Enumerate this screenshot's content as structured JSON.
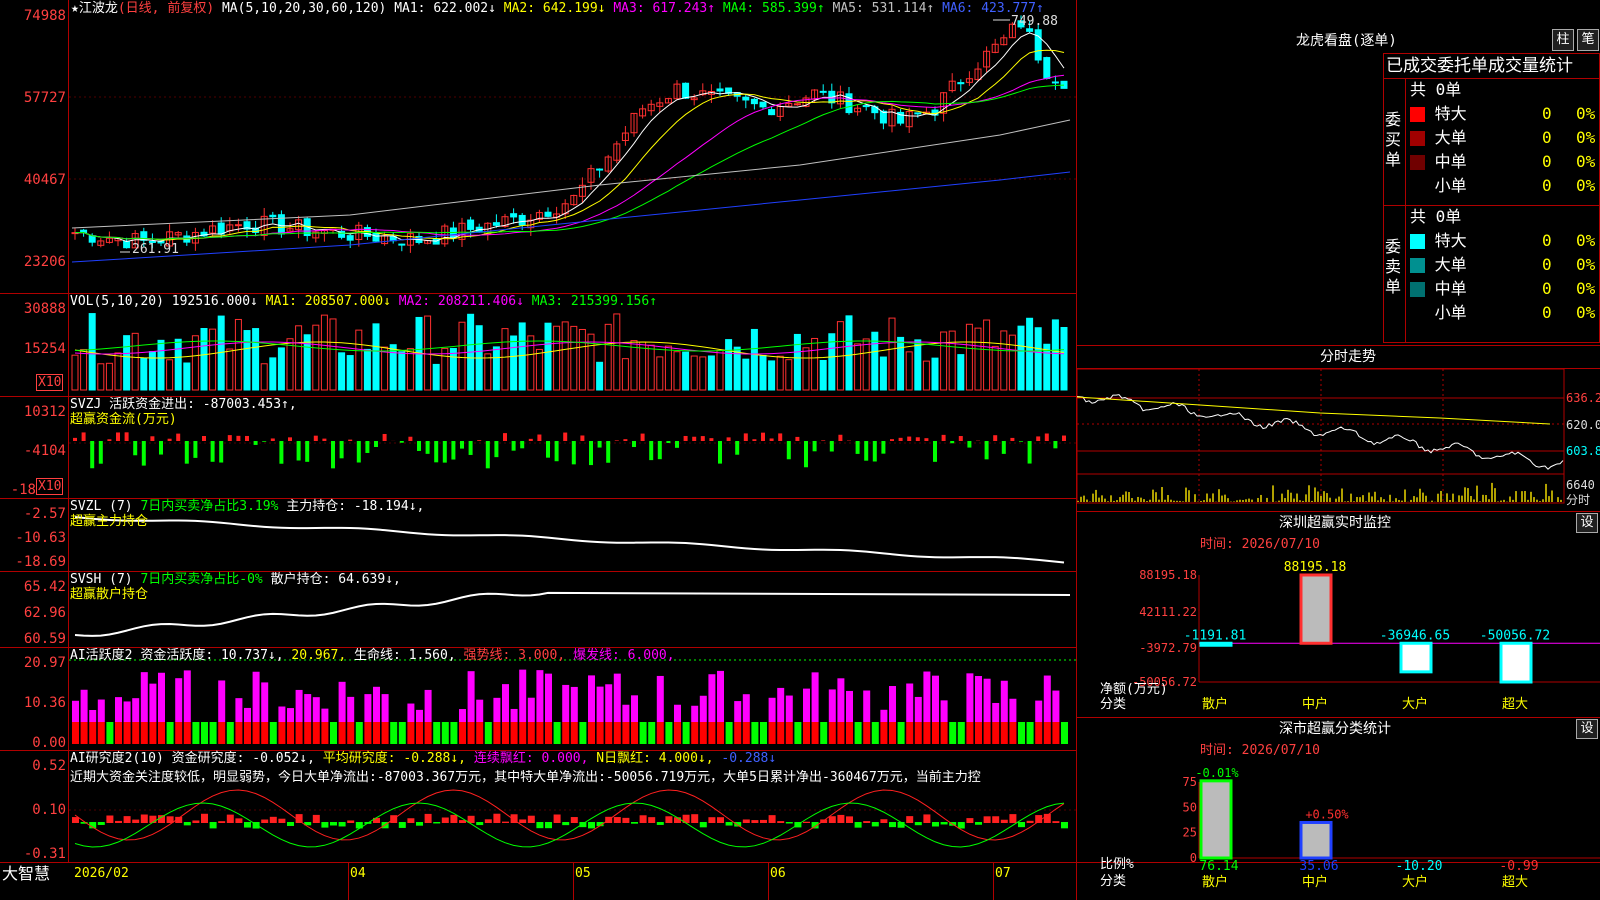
{
  "stock": {
    "title": "江波龙",
    "mode": "(日线, 前复权)",
    "ma_label": "MA(5,10,20,30,60,120)",
    "ma": [
      {
        "t": "MA1: 622.002↓",
        "c": "#ffffff"
      },
      {
        "t": "MA2: 642.199↓",
        "c": "#ffff00"
      },
      {
        "t": "MA3: 617.243↑",
        "c": "#ff00ff"
      },
      {
        "t": "MA4: 585.399↑",
        "c": "#00ff00"
      },
      {
        "t": "MA5: 531.114↑",
        "c": "#c0c0c0"
      },
      {
        "t": "MA6: 423.777↑",
        "c": "#4060ff"
      }
    ],
    "y_labels": [
      "74988",
      "57727",
      "40467",
      "23206"
    ],
    "high_label": "749.88",
    "low_label": "261.91"
  },
  "vol": {
    "title": "VOL(5,10,20)",
    "value": "192516.000↓",
    "ma1": "MA1: 208507.000↓",
    "ma2": "MA2: 208211.406↓",
    "ma3": "MA3: 215399.156↑",
    "y_labels": [
      "30888",
      "15254"
    ],
    "unit": "X10"
  },
  "svzj": {
    "title": "SVZJ",
    "desc": "活跃资金进出: -87003.453↑,",
    "sub": "超赢资金流(万元)",
    "y_labels": [
      "10312",
      "-4104",
      "-18"
    ],
    "unit": "X10"
  },
  "svzl": {
    "title": "SVZL (7)",
    "desc": "7日内买卖净占比3.19%",
    "desc2": "主力持仓: -18.194↓,",
    "sub": "超赢主力持仓",
    "y_labels": [
      "-2.57",
      "-10.63",
      "-18.69"
    ]
  },
  "svsh": {
    "title": "SVSH (7)",
    "desc": "7日内买卖净占比-0%",
    "desc2": "散户持仓: 64.639↓,",
    "sub": "超赢散户持仓",
    "y_labels": [
      "65.42",
      "62.96",
      "60.59"
    ]
  },
  "ai1": {
    "title": "AI活跃度2",
    "t1": "资金活跃度: 10.737↓,",
    "t2": "20.967,",
    "t3": "生命线: 1.560,",
    "t4": "强势线: 3.000,",
    "t5": "爆发线: 6.000,",
    "y_labels": [
      "20.97",
      "10.36",
      "0.00"
    ]
  },
  "ai2": {
    "title": "AI研究度2(10)",
    "t1": "资金研究度: -0.052↓,",
    "t2": "平均研究度: -0.288↓,",
    "t3": "连续飘红: 0.000,",
    "t4": "N日飘红: 4.000↓,",
    "t5": "-0.288↓",
    "text": "近期大资金关注度较低，明显弱势，今日大单净流出:-87003.367万元，其中特大单净流出:-50056.719万元，大单5日累计净出-360467万元，当前主力控",
    "y_labels": [
      "0.52",
      "0.10",
      "-0.31"
    ]
  },
  "bottom": {
    "app": "大智慧",
    "dates": [
      "2026/02",
      "04",
      "05",
      "06",
      "07"
    ]
  },
  "lhb": {
    "title": "龙虎看盘(逐单)",
    "btn1": "柱",
    "btn2": "笔",
    "header": "已成交委托单成交量统计",
    "buy": {
      "side": "委买单",
      "total": "共 0单",
      "rows": [
        {
          "name": "特大",
          "v": "0",
          "p": "0%",
          "c": "#ff0000"
        },
        {
          "name": "大单",
          "v": "0",
          "p": "0%",
          "c": "#a00000"
        },
        {
          "name": "中单",
          "v": "0",
          "p": "0%",
          "c": "#700000"
        },
        {
          "name": "小单",
          "v": "0",
          "p": "0%",
          "c": "#000000"
        }
      ]
    },
    "sell": {
      "side": "委卖单",
      "total": "共 0单",
      "rows": [
        {
          "name": "特大",
          "v": "0",
          "p": "0%",
          "c": "#00ffff"
        },
        {
          "name": "大单",
          "v": "0",
          "p": "0%",
          "c": "#009090"
        },
        {
          "name": "中单",
          "v": "0",
          "p": "0%",
          "c": "#007070"
        },
        {
          "name": "小单",
          "v": "0",
          "p": "0%",
          "c": "#000000"
        }
      ]
    }
  },
  "fenshi": {
    "title": "分时走势",
    "y_labels": [
      "636.2",
      "620.0",
      "603.8"
    ],
    "vol_label": "6640",
    "vol_unit": "分时"
  },
  "szcy": {
    "title": "深圳超赢实时监控",
    "btn": "设",
    "time": "时间: 2026/07/10",
    "y_labels": [
      "88195.18",
      "42111.22",
      "-3972.79",
      "-50056.72"
    ],
    "axis_label": "净额(万元)",
    "cat_label": "分类",
    "chart_data": {
      "type": "bar",
      "categories": [
        "散户",
        "中户",
        "大户",
        "超大"
      ],
      "values": [
        -1191.81,
        88195.18,
        -36946.65,
        -50056.72
      ],
      "value_labels": [
        "-1191.81",
        "88195.18",
        "-36946.65",
        "-50056.72"
      ],
      "ylim": [
        -50056.72,
        88195.18
      ]
    }
  },
  "scfl": {
    "title": "深市超赢分类统计",
    "btn": "设",
    "time": "时间: 2026/07/10",
    "y_labels": [
      "75",
      "50",
      "25",
      "0"
    ],
    "axis_label": "比例%",
    "cat_label": "分类",
    "chart_data": {
      "type": "bar",
      "categories": [
        "散户",
        "中户",
        "大户",
        "超大"
      ],
      "values": [
        76.14,
        35.06,
        -10.2,
        -0.99
      ],
      "changes": [
        "-0.01%",
        "+0.50%",
        "",
        ""
      ],
      "value_labels": [
        "76.14",
        "35.06",
        "-10.20",
        "-0.99"
      ],
      "ylim": [
        0,
        75
      ]
    }
  }
}
